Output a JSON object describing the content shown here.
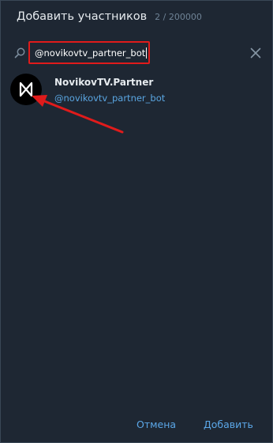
{
  "dialog": {
    "title": "Добавить участников",
    "member_count": "2 / 200000"
  },
  "search": {
    "value": "@novikovtv_partner_bot"
  },
  "results": [
    {
      "name": "NovikovTV.Partner",
      "username": "@novikovtv_partner_bot",
      "icon": "hourglass-logo-icon"
    }
  ],
  "footer": {
    "cancel_label": "Отмена",
    "add_label": "Добавить"
  },
  "colors": {
    "background": "#1e2733",
    "accent": "#5ba7e8",
    "highlight": "#e01b1b"
  }
}
